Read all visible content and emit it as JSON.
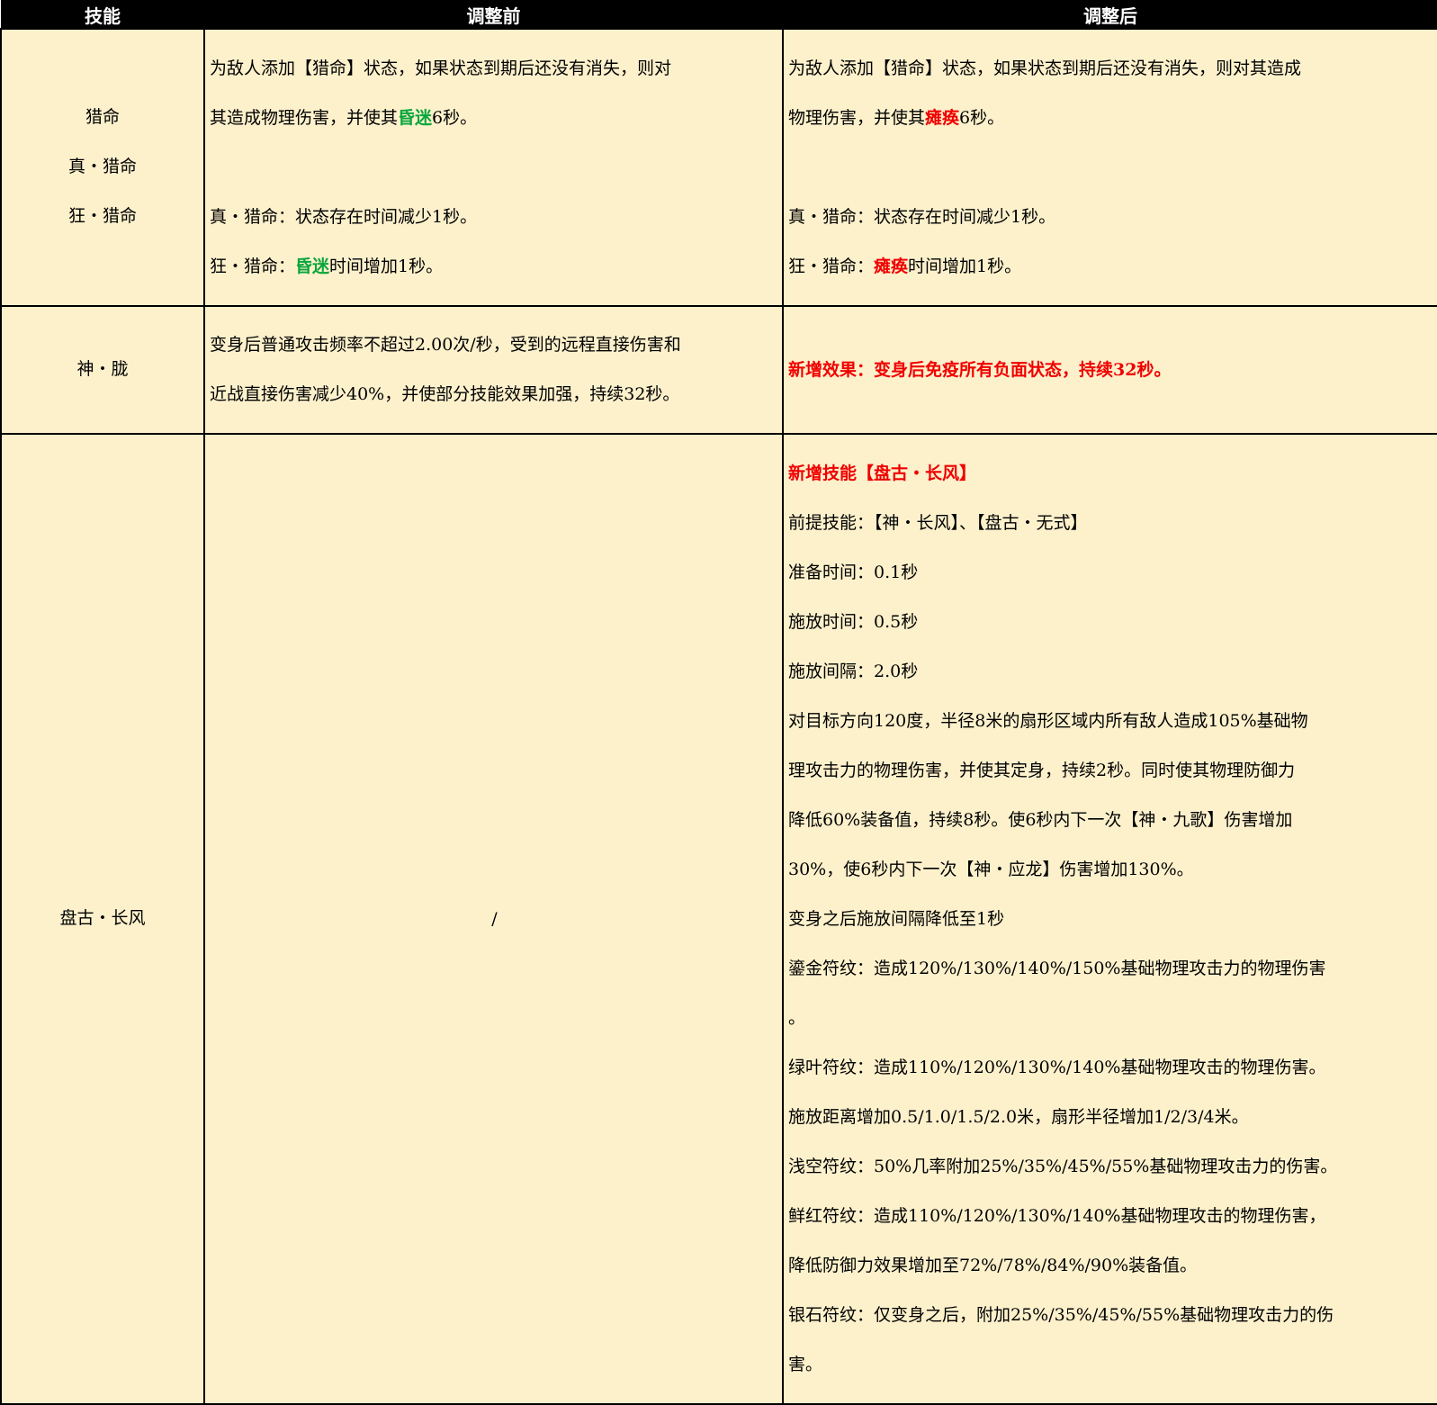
{
  "headers": {
    "skill": "技能",
    "before": "调整前",
    "after": "调整后"
  },
  "colors": {
    "header_bg": "#000000",
    "cell_bg": "#fdf1cc",
    "highlight_green": "#0aa63c",
    "highlight_red": "#f00000"
  },
  "rows": [
    {
      "name_lines": [
        "猎命",
        "真・猎命",
        "狂・猎命"
      ],
      "before": {
        "l1": "为敌人添加【猎命】状态，如果状态到期后还没有消失，则对",
        "l2_pre": "其造成物理伤害，并使其",
        "l2_hl": "昏迷",
        "l2_post": "6秒。",
        "l3": "真・猎命：状态存在时间减少1秒。",
        "l4_pre": "狂・猎命：",
        "l4_hl": "昏迷",
        "l4_post": "时间增加1秒。"
      },
      "after": {
        "l1": "为敌人添加【猎命】状态，如果状态到期后还没有消失，则对其造成",
        "l2_pre": "物理伤害，并使其",
        "l2_hl": "瘫痪",
        "l2_post": "6秒。",
        "l3": "真・猎命：状态存在时间减少1秒。",
        "l4_pre": "狂・猎命：",
        "l4_hl": "瘫痪",
        "l4_post": "时间增加1秒。"
      }
    },
    {
      "name": "神・胧",
      "before_lines": [
        "变身后普通攻击频率不超过2.00次/秒，受到的远程直接伤害和",
        "近战直接伤害减少40%，并使部分技能效果加强，持续32秒。"
      ],
      "after": "新增效果：变身后免疫所有负面状态，持续32秒。"
    },
    {
      "name": "盘古・长风",
      "before": "/",
      "after_title": "新增技能【盘古・长风】",
      "after_lines": [
        "前提技能：【神・长风】、【盘古・无式】",
        "准备时间：0.1秒",
        "施放时间：0.5秒",
        "施放间隔：2.0秒",
        "对目标方向120度，半径8米的扇形区域内所有敌人造成105%基础物",
        "理攻击力的物理伤害，并使其定身，持续2秒。同时使其物理防御力",
        "降低60%装备值，持续8秒。使6秒内下一次【神・九歌】伤害增加",
        "30%，使6秒内下一次【神・应龙】伤害增加130%。",
        "变身之后施放间隔降低至1秒",
        "鎏金符纹：造成120%/130%/140%/150%基础物理攻击力的物理伤害",
        "。",
        "绿叶符纹：造成110%/120%/130%/140%基础物理攻击的物理伤害。",
        "施放距离增加0.5/1.0/1.5/2.0米，扇形半径增加1/2/3/4米。",
        "浅空符纹：50%几率附加25%/35%/45%/55%基础物理攻击力的伤害。",
        "鲜红符纹：造成110%/120%/130%/140%基础物理攻击的物理伤害，",
        "降低防御力效果增加至72%/78%/84%/90%装备值。",
        "银石符纹：仅变身之后，附加25%/35%/45%/55%基础物理攻击力的伤",
        "害。"
      ]
    }
  ]
}
